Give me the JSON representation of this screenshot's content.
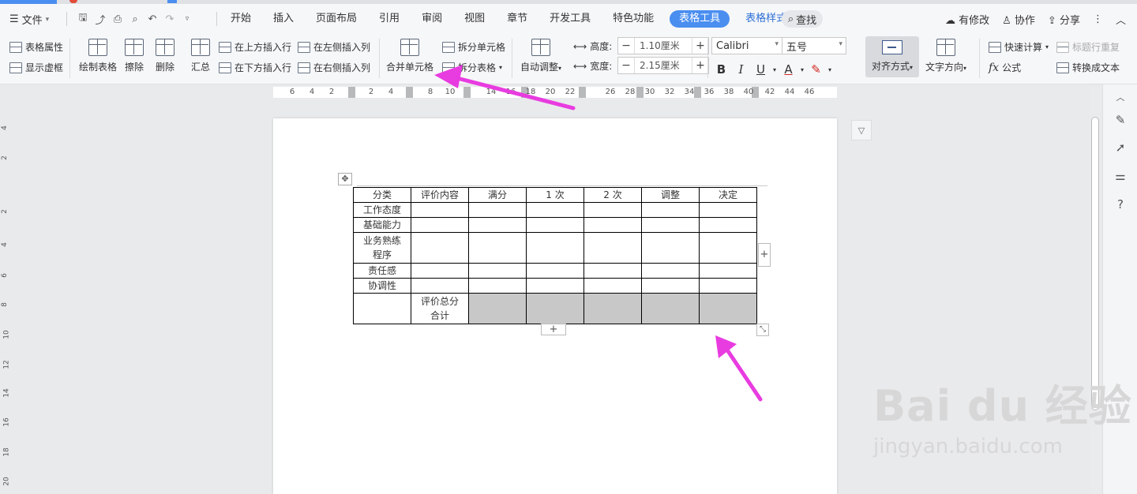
{
  "menubar": {
    "file_label": "文件",
    "items": [
      "开始",
      "插入",
      "页面布局",
      "引用",
      "审阅",
      "视图",
      "章节",
      "开发工具",
      "特色功能"
    ],
    "active_tab": "表格工具",
    "style_tab": "表格样式",
    "search_label": "查找",
    "modified_label": "有修改",
    "collab_label": "协作",
    "share_label": "分享"
  },
  "ribbon": {
    "table_props": "表格属性",
    "show_gridlines": "显示虚框",
    "draw_table": "绘制表格",
    "erase": "擦除",
    "delete": "删除",
    "summary": "汇总",
    "insert_above": "在上方插入行",
    "insert_below": "在下方插入行",
    "insert_left": "在左侧插入列",
    "insert_right": "在右侧插入列",
    "merge_cells": "合并单元格",
    "split_cells": "拆分单元格",
    "split_table": "拆分表格",
    "auto_adjust": "自动调整",
    "height_label": "高度:",
    "height_value": "1.10厘米",
    "width_label": "宽度:",
    "width_value": "2.15厘米",
    "font_name": "Calibri",
    "font_size": "五号",
    "align": "对齐方式",
    "text_direction": "文字方向",
    "quick_calc": "快速计算",
    "formula": "公式",
    "header_repeat": "标题行重复",
    "convert_text": "转换成文本"
  },
  "ruler": {
    "labels": [
      "6",
      "4",
      "2",
      "2",
      "4",
      "8",
      "10",
      "14",
      "16",
      "18",
      "20",
      "22",
      "26",
      "28",
      "30",
      "32",
      "34",
      "36",
      "38",
      "40",
      "42",
      "44",
      "46"
    ]
  },
  "vruler": {
    "labels": [
      "4",
      "2",
      "2",
      "4",
      "6",
      "8",
      "10",
      "12",
      "14",
      "16",
      "18",
      "20"
    ]
  },
  "table": {
    "header": [
      "分类",
      "评价内容",
      "满分",
      "1 次",
      "2 次",
      "调整",
      "决定"
    ],
    "rows": [
      {
        "c0": "工作态度"
      },
      {
        "c0": "基础能力"
      },
      {
        "c0": "业务熟练程序"
      },
      {
        "c0": "责任感"
      },
      {
        "c0": "协调性"
      },
      {
        "c0": "",
        "c1": "评价总分合计"
      }
    ]
  },
  "watermark": {
    "line1": "Bai du 经验",
    "line2": "jingyan.baidu.com"
  },
  "colors": {
    "accent": "#4a8ef0",
    "arrow": "#e83ce0",
    "shaded_cell": "#c8c8c8"
  }
}
